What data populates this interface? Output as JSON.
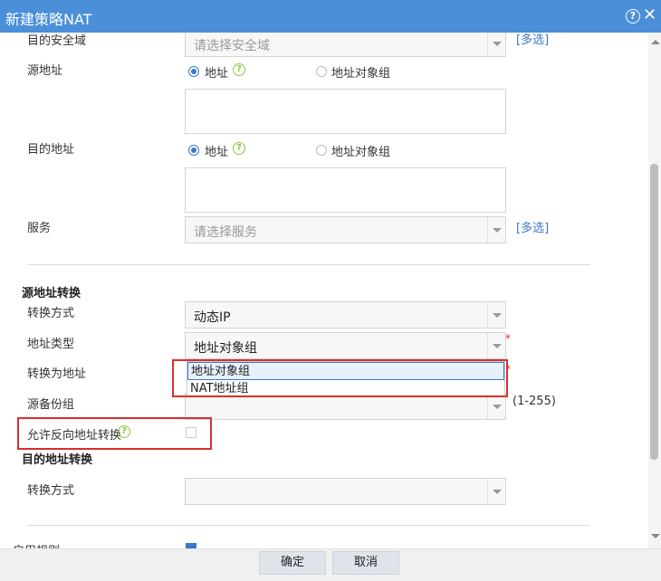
{
  "dialog": {
    "title": "新建策略NAT"
  },
  "match": {
    "dest_zone": {
      "label": "目的安全域",
      "placeholder": "请选择安全域",
      "multi_link": "[多选]"
    },
    "src_addr": {
      "label": "源地址",
      "radio_address": "地址",
      "radio_group": "地址对象组"
    },
    "dest_addr": {
      "label": "目的地址",
      "radio_address": "地址",
      "radio_group": "地址对象组"
    },
    "service": {
      "label": "服务",
      "placeholder": "请选择服务",
      "multi_link": "[多选]"
    }
  },
  "src_nat": {
    "section_title": "源地址转换",
    "method": {
      "label": "转换方式",
      "value": "动态IP"
    },
    "addr_type": {
      "label": "地址类型",
      "value": "地址对象组",
      "required": "*"
    },
    "to_addr": {
      "label": "转换为地址",
      "required": "*"
    },
    "dropdown_options": [
      "地址对象组",
      "NAT地址组"
    ],
    "backup": {
      "label": "源备份组",
      "hint": "(1-255)"
    },
    "reverse": {
      "label": "允许反向地址转换"
    }
  },
  "dst_nat": {
    "section_title": "目的地址转换",
    "method": {
      "label": "转换方式"
    }
  },
  "enable_rule": {
    "label": "启用规则"
  },
  "footer": {
    "ok": "确定",
    "cancel": "取消"
  },
  "icons": {
    "help": "?",
    "close": "✕",
    "question": "?"
  }
}
